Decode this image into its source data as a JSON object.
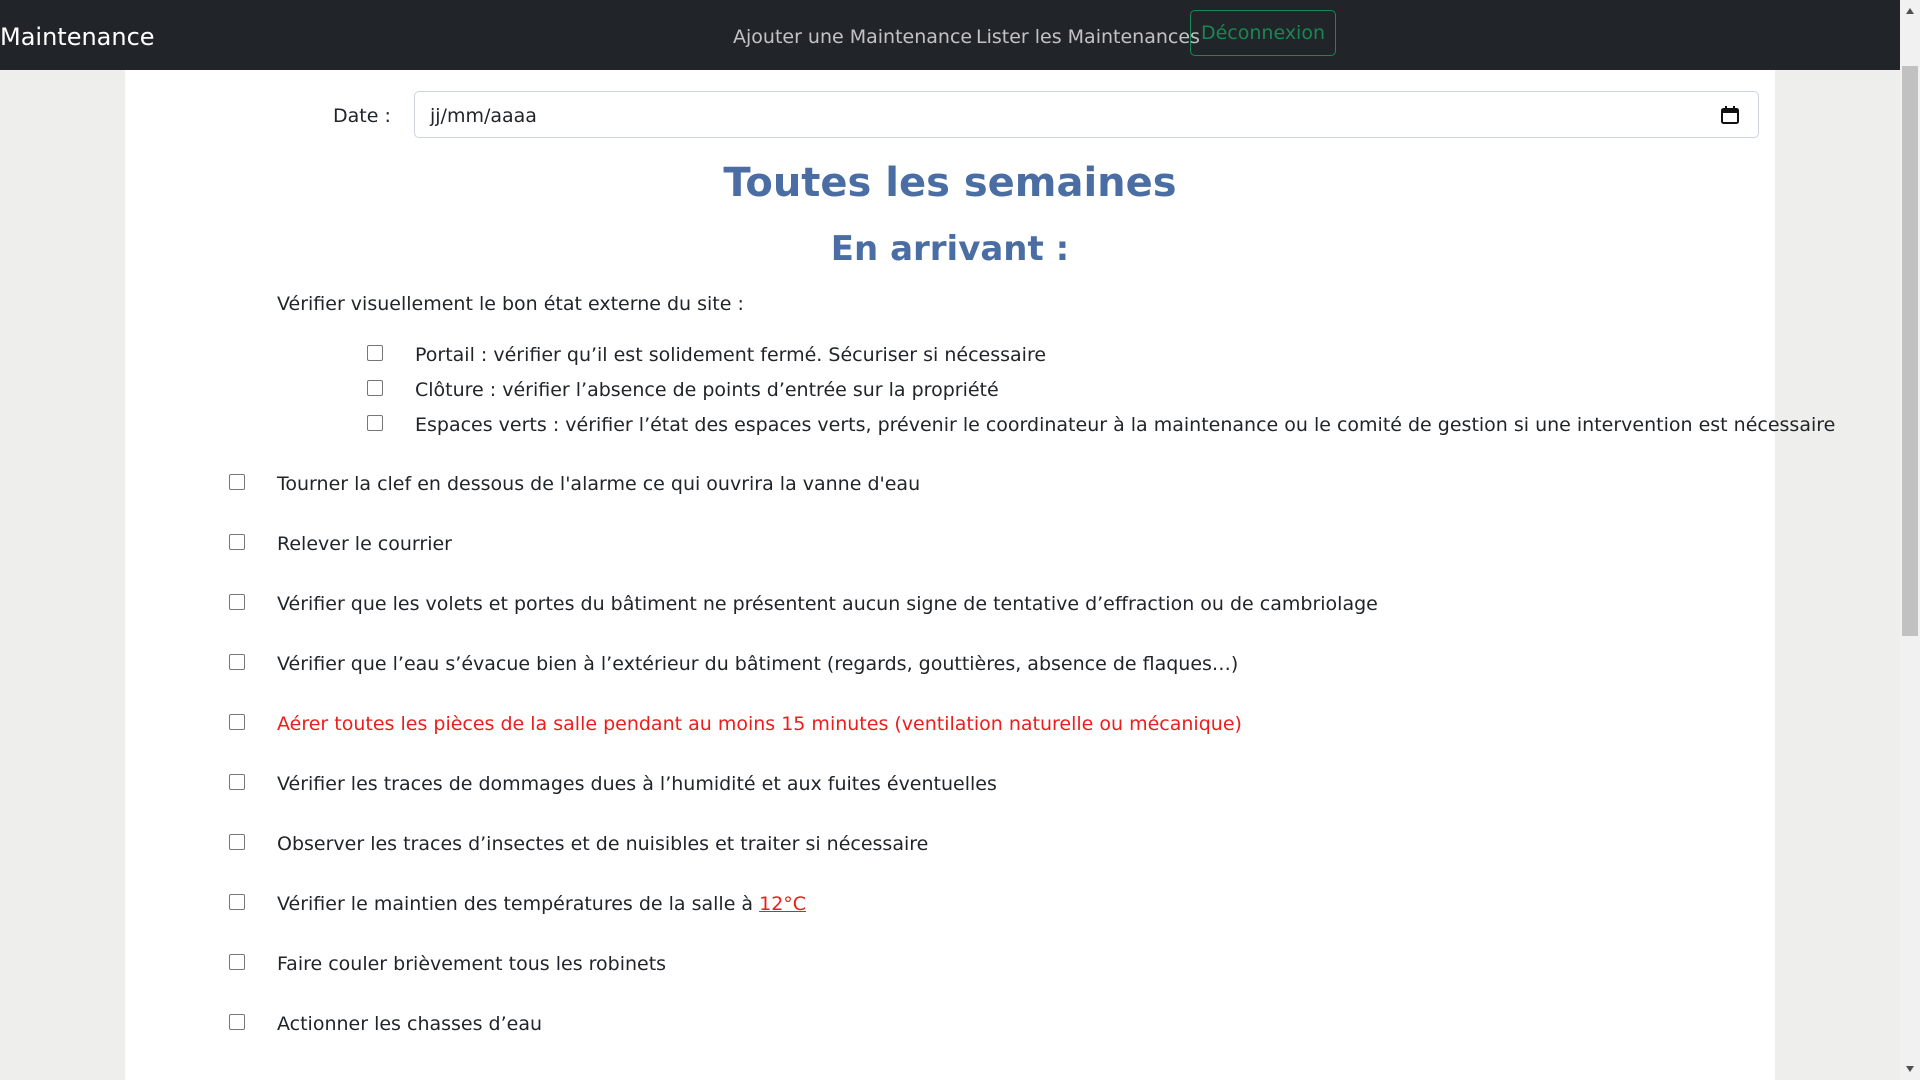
{
  "navbar": {
    "brand": "Maintenance",
    "add_link": "Ajouter une Maintenance",
    "list_link": "Lister les Maintenances",
    "logout_button": "Déconnexion"
  },
  "form": {
    "date_label": "Date :",
    "date_placeholder": "jj/mm/aaaa"
  },
  "section": {
    "title": "Toutes les semaines",
    "subtitle": "En arrivant :",
    "intro": "Vérifier visuellement le bon état externe du site :"
  },
  "sub_items": [
    {
      "label": "Portail : vérifier qu’il est solidement fermé. Sécuriser si nécessaire",
      "checked": false
    },
    {
      "label": "Clôture : vérifier l’absence de points d’entrée sur la propriété",
      "checked": false
    },
    {
      "label": "Espaces verts : vérifier l’état des espaces verts, prévenir le coordinateur à la maintenance ou le comité de gestion si une intervention est nécessaire",
      "checked": false
    }
  ],
  "items": [
    {
      "label": "Tourner la clef en dessous de l'alarme ce qui ouvrira la vanne d'eau",
      "checked": false
    },
    {
      "label": "Relever le courrier",
      "checked": false
    },
    {
      "label": "Vérifier que les volets et portes du bâtiment ne présentent aucun signe de tentative d’effraction ou de cambriolage",
      "checked": false
    },
    {
      "label": "Vérifier que l’eau s’évacue bien à l’extérieur du bâtiment (regards, gouttières, absence de flaques…)",
      "checked": false
    },
    {
      "label": "Aérer toutes les pièces de la salle pendant au moins 15 minutes (ventilation naturelle ou mécanique)",
      "checked": false
    },
    {
      "label": "Vérifier les traces de dommages dues à l’humidité et aux fuites éventuelles",
      "checked": false
    },
    {
      "label": "Observer les traces d’insectes et de nuisibles et traiter si nécessaire",
      "checked": false
    },
    {
      "label": "Vérifier le maintien des températures de la salle à ",
      "link": "12°C",
      "checked": false
    },
    {
      "label": "Faire couler brièvement tous les robinets",
      "checked": false
    },
    {
      "label": "Actionner les chasses d’eau",
      "checked": false
    }
  ],
  "colors": {
    "navbar_bg": "#212529",
    "heading": "#4a6ea3",
    "alert_text": "#ee1c1c",
    "logout_outline": "#198754"
  }
}
